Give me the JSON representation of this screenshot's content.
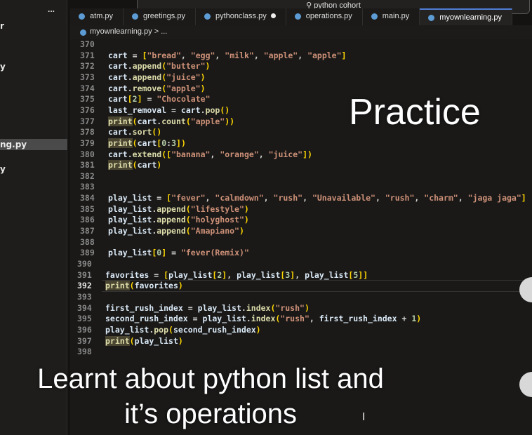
{
  "sidebar": {
    "more": "...",
    "fragments": [
      "r",
      "y",
      "ng.py",
      "y"
    ]
  },
  "search": {
    "label": "python cohort"
  },
  "tabs": [
    {
      "label": "atm.py",
      "modified": false,
      "active": false
    },
    {
      "label": "greetings.py",
      "modified": false,
      "active": false
    },
    {
      "label": "pythonclass.py",
      "modified": true,
      "active": false
    },
    {
      "label": "operations.py",
      "modified": false,
      "active": false
    },
    {
      "label": "main.py",
      "modified": false,
      "active": false
    },
    {
      "label": "myownlearning.py",
      "modified": false,
      "active": true
    }
  ],
  "breadcrumb": "myownlearning.py > ...",
  "editor": {
    "current_line": 392,
    "lines": [
      {
        "n": 370,
        "code": ""
      },
      {
        "n": 371,
        "code": "cart = [\"bread\", \"egg\", \"milk\", \"apple\", \"apple\"]"
      },
      {
        "n": 372,
        "code": "cart.append(\"butter\")"
      },
      {
        "n": 373,
        "code": "cart.append(\"juice\")"
      },
      {
        "n": 374,
        "code": "cart.remove(\"apple\")"
      },
      {
        "n": 375,
        "code": "cart[2] = \"Chocolate\""
      },
      {
        "n": 376,
        "code": "last_removal = cart.pop()"
      },
      {
        "n": 377,
        "code": "print(cart.count(\"apple\"))"
      },
      {
        "n": 378,
        "code": "cart.sort()"
      },
      {
        "n": 379,
        "code": "print(cart[0:3])"
      },
      {
        "n": 380,
        "code": "cart.extend([\"banana\", \"orange\", \"juice\"])"
      },
      {
        "n": 381,
        "code": "print(cart)"
      },
      {
        "n": 382,
        "code": ""
      },
      {
        "n": 383,
        "code": ""
      },
      {
        "n": 384,
        "code": "play_list = [\"fever\", \"calmdown\", \"rush\", \"Unavailable\", \"rush\", \"charm\", \"jaga jaga\"]"
      },
      {
        "n": 385,
        "code": "play_list.append(\"lifestyle\")"
      },
      {
        "n": 386,
        "code": "play_list.append(\"holyghost\")"
      },
      {
        "n": 387,
        "code": "play_list.append(\"Amapiano\")"
      },
      {
        "n": 388,
        "code": ""
      },
      {
        "n": 389,
        "code": "play_list[0] = \"fever(Remix)\""
      },
      {
        "n": 390,
        "code": ""
      },
      {
        "n": 391,
        "code": "favorites = [play_list[2], play_list[3], play_list[5]]"
      },
      {
        "n": 392,
        "code": "print(favorites)"
      },
      {
        "n": 393,
        "code": ""
      },
      {
        "n": 394,
        "code": "first_rush_index = play_list.index(\"rush\")"
      },
      {
        "n": 395,
        "code": "second_rush_index = play_list.index(\"rush\", first_rush_index + 1)"
      },
      {
        "n": 396,
        "code": "play_list.pop(second_rush_index)"
      },
      {
        "n": 397,
        "code": "print(play_list)"
      },
      {
        "n": 398,
        "code": ""
      }
    ]
  },
  "overlay": {
    "title": "Practice",
    "caption_line1": "Learnt about python list and",
    "caption_line2": "it’s operations"
  }
}
